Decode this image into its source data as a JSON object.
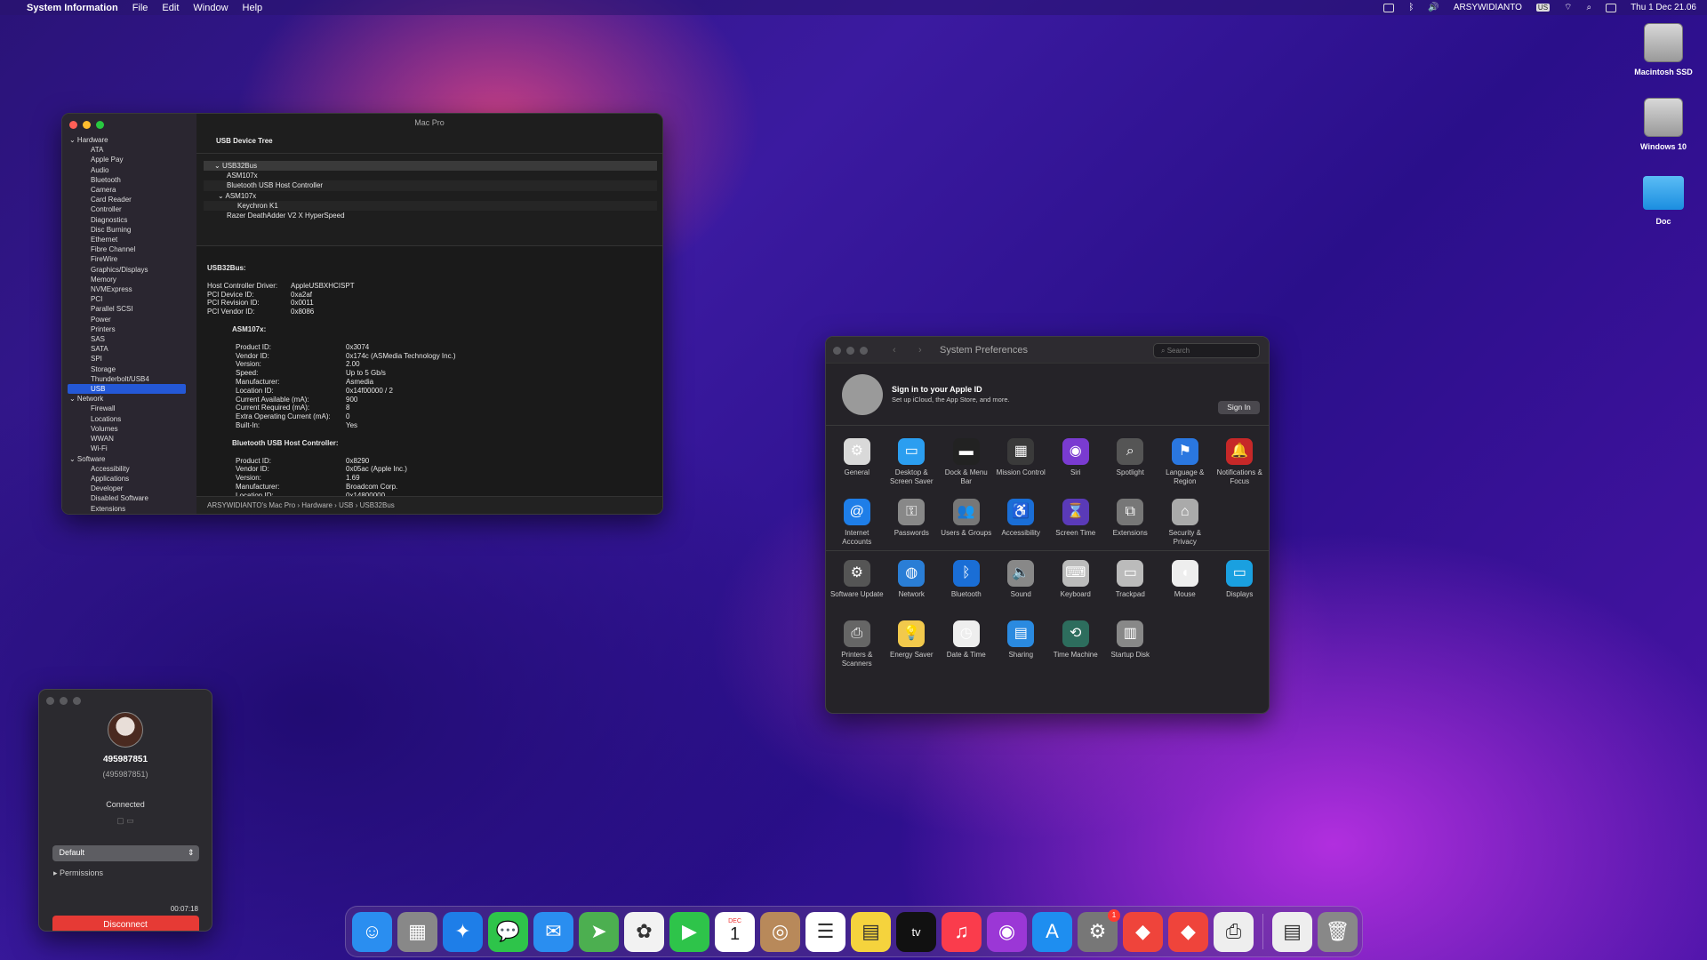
{
  "menubar": {
    "app": "System Information",
    "menus": [
      "File",
      "Edit",
      "Window",
      "Help"
    ],
    "user": "ARSYWIDIANTO",
    "input": "US",
    "clock": "Thu 1 Dec  21.06"
  },
  "desktop": {
    "icons": [
      "Macintosh SSD",
      "Windows 10",
      "Doc"
    ]
  },
  "sysinfo": {
    "title": "Mac Pro",
    "sidebar": [
      {
        "group": "Hardware",
        "items": [
          "ATA",
          "Apple Pay",
          "Audio",
          "Bluetooth",
          "Camera",
          "Card Reader",
          "Controller",
          "Diagnostics",
          "Disc Burning",
          "Ethernet",
          "Fibre Channel",
          "FireWire",
          "Graphics/Displays",
          "Memory",
          "NVMExpress",
          "PCI",
          "Parallel SCSI",
          "Power",
          "Printers",
          "SAS",
          "SATA",
          "SPI",
          "Storage",
          "Thunderbolt/USB4",
          "USB"
        ]
      },
      {
        "group": "Network",
        "items": [
          "Firewall",
          "Locations",
          "Volumes",
          "WWAN",
          "Wi-Fi"
        ]
      },
      {
        "group": "Software",
        "items": [
          "Accessibility",
          "Applications",
          "Developer",
          "Disabled Software",
          "Extensions"
        ]
      }
    ],
    "selected": "USB",
    "section": "USB Device Tree",
    "tree": [
      "USB32Bus",
      "ASM107x",
      "Bluetooth USB Host Controller",
      "ASM107x",
      "Keychron K1",
      "Razer DeathAdder V2 X HyperSpeed"
    ],
    "detail_title": "USB32Bus:",
    "bus": [
      [
        "Host Controller Driver:",
        "AppleUSBXHCISPT"
      ],
      [
        "PCI Device ID:",
        "0xa2af"
      ],
      [
        "PCI Revision ID:",
        "0x0011"
      ],
      [
        "PCI Vendor ID:",
        "0x8086"
      ]
    ],
    "asm_title": "ASM107x:",
    "asm": [
      [
        "Product ID:",
        "0x3074"
      ],
      [
        "Vendor ID:",
        "0x174c  (ASMedia Technology Inc.)"
      ],
      [
        "Version:",
        "2.00"
      ],
      [
        "Speed:",
        "Up to 5 Gb/s"
      ],
      [
        "Manufacturer:",
        "Asmedia"
      ],
      [
        "Location ID:",
        "0x14f00000 / 2"
      ],
      [
        "Current Available (mA):",
        "900"
      ],
      [
        "Current Required (mA):",
        "8"
      ],
      [
        "Extra Operating Current (mA):",
        "0"
      ],
      [
        "Built-In:",
        "Yes"
      ]
    ],
    "bt_title": "Bluetooth USB Host Controller:",
    "bt": [
      [
        "Product ID:",
        "0x8290"
      ],
      [
        "Vendor ID:",
        "0x05ac (Apple Inc.)"
      ],
      [
        "Version:",
        "1.69"
      ],
      [
        "Manufacturer:",
        "Broadcom Corp."
      ],
      [
        "Location ID:",
        "0x14800000"
      ]
    ],
    "path": "ARSYWIDIANTO's Mac Pro › Hardware › USB › USB32Bus"
  },
  "conn": {
    "id": "495987851",
    "sub_id": "(495987851)",
    "status": "Connected",
    "select": "Default",
    "permissions": "Permissions",
    "timer": "00:07:18",
    "disconnect": "Disconnect"
  },
  "prefs": {
    "title": "System Preferences",
    "search": "Search",
    "signin_title": "Sign in to your Apple ID",
    "signin_sub": "Set up iCloud, the App Store, and more.",
    "signin_btn": "Sign In",
    "row1": [
      "General",
      "Desktop & Screen Saver",
      "Dock & Menu Bar",
      "Mission Control",
      "Siri",
      "Spotlight",
      "Language & Region",
      "Notifications & Focus"
    ],
    "row2": [
      "Internet Accounts",
      "Passwords",
      "Users & Groups",
      "Accessibility",
      "Screen Time",
      "Extensions",
      "Security & Privacy"
    ],
    "row3": [
      "Software Update",
      "Network",
      "Bluetooth",
      "Sound",
      "Keyboard",
      "Trackpad",
      "Mouse",
      "Displays"
    ],
    "row4": [
      "Printers & Scanners",
      "Energy Saver",
      "Date & Time",
      "Sharing",
      "Time Machine",
      "Startup Disk"
    ]
  },
  "dock": {
    "badge_prefs": "1",
    "calendar_month": "DEC",
    "calendar_day": "1",
    "tv": "tv"
  }
}
